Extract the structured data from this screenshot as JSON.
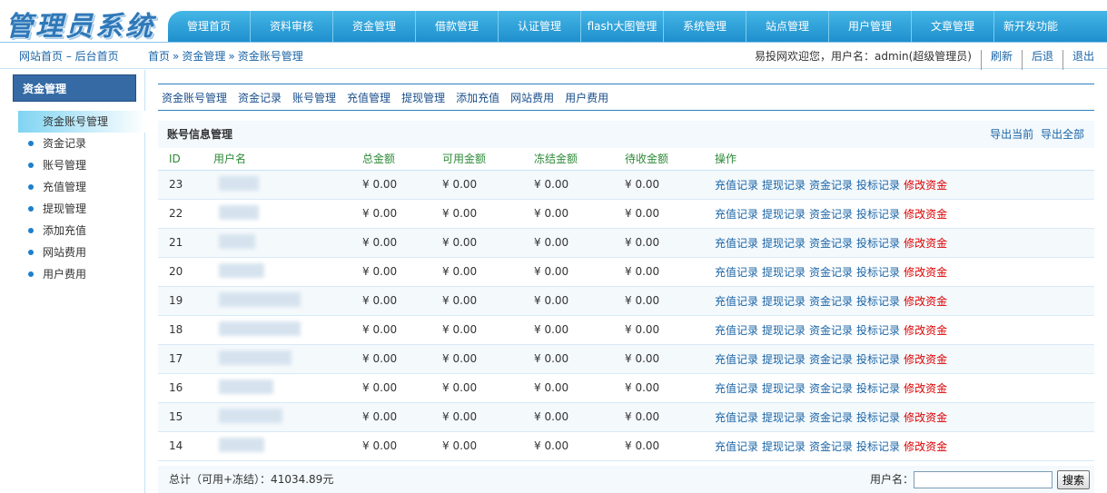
{
  "app": {
    "logo": "管理员系统"
  },
  "topnav": [
    "管理首页",
    "资料审核",
    "资金管理",
    "借款管理",
    "认证管理",
    "flash大图管理",
    "系统管理",
    "站点管理",
    "用户管理",
    "文章管理",
    "新开发功能"
  ],
  "subbar": {
    "site_home": "网站首页",
    "dash": " – ",
    "admin_home": "后台首页",
    "breadcrumb": [
      "首页",
      "资金管理",
      "资金账号管理"
    ],
    "breadcrumb_sep": "»",
    "welcome": "易投网欢迎您，用户名：admin(超级管理员)",
    "refresh": "刷新",
    "back": "后退",
    "logout": "退出"
  },
  "sidebar": {
    "title": "资金管理",
    "items": [
      {
        "label": "资金账号管理",
        "active": true
      },
      {
        "label": "资金记录"
      },
      {
        "label": "账号管理"
      },
      {
        "label": "充值管理"
      },
      {
        "label": "提现管理"
      },
      {
        "label": "添加充值"
      },
      {
        "label": "网站费用"
      },
      {
        "label": "用户费用"
      }
    ]
  },
  "tabs": [
    "资金账号管理",
    "资金记录",
    "账号管理",
    "充值管理",
    "提现管理",
    "添加充值",
    "网站费用",
    "用户费用"
  ],
  "panel": {
    "title": "账号信息管理",
    "export_current": "导出当前",
    "export_all": "导出全部"
  },
  "table": {
    "columns": [
      "ID",
      "用户名",
      "总金额",
      "可用金额",
      "冻结金额",
      "待收金额",
      "操作"
    ],
    "actions": [
      "充值记录",
      "提现记录",
      "资金记录",
      "投标记录",
      "修改资金"
    ],
    "rows": [
      {
        "id": "23",
        "total": "¥ 0.00",
        "available": "¥ 0.00",
        "frozen": "¥ 0.00",
        "pending": "¥ 0.00"
      },
      {
        "id": "22",
        "total": "¥ 0.00",
        "available": "¥ 0.00",
        "frozen": "¥ 0.00",
        "pending": "¥ 0.00"
      },
      {
        "id": "21",
        "total": "¥ 0.00",
        "available": "¥ 0.00",
        "frozen": "¥ 0.00",
        "pending": "¥ 0.00"
      },
      {
        "id": "20",
        "total": "¥ 0.00",
        "available": "¥ 0.00",
        "frozen": "¥ 0.00",
        "pending": "¥ 0.00"
      },
      {
        "id": "19",
        "total": "¥ 0.00",
        "available": "¥ 0.00",
        "frozen": "¥ 0.00",
        "pending": "¥ 0.00"
      },
      {
        "id": "18",
        "total": "¥ 0.00",
        "available": "¥ 0.00",
        "frozen": "¥ 0.00",
        "pending": "¥ 0.00"
      },
      {
        "id": "17",
        "total": "¥ 0.00",
        "available": "¥ 0.00",
        "frozen": "¥ 0.00",
        "pending": "¥ 0.00"
      },
      {
        "id": "16",
        "total": "¥ 0.00",
        "available": "¥ 0.00",
        "frozen": "¥ 0.00",
        "pending": "¥ 0.00"
      },
      {
        "id": "15",
        "total": "¥ 0.00",
        "available": "¥ 0.00",
        "frozen": "¥ 0.00",
        "pending": "¥ 0.00"
      },
      {
        "id": "14",
        "total": "¥ 0.00",
        "available": "¥ 0.00",
        "frozen": "¥ 0.00",
        "pending": "¥ 0.00"
      }
    ]
  },
  "footer": {
    "total": "总计（可用+冻结）：41034.89元",
    "search_label": "用户名：",
    "search_value": "",
    "search_button": "搜索"
  },
  "colors": {
    "nav": "#1e8fcd",
    "sidebar_head": "#356aa4",
    "header_text": "#2e8a38",
    "edit_link": "#dd0000"
  }
}
